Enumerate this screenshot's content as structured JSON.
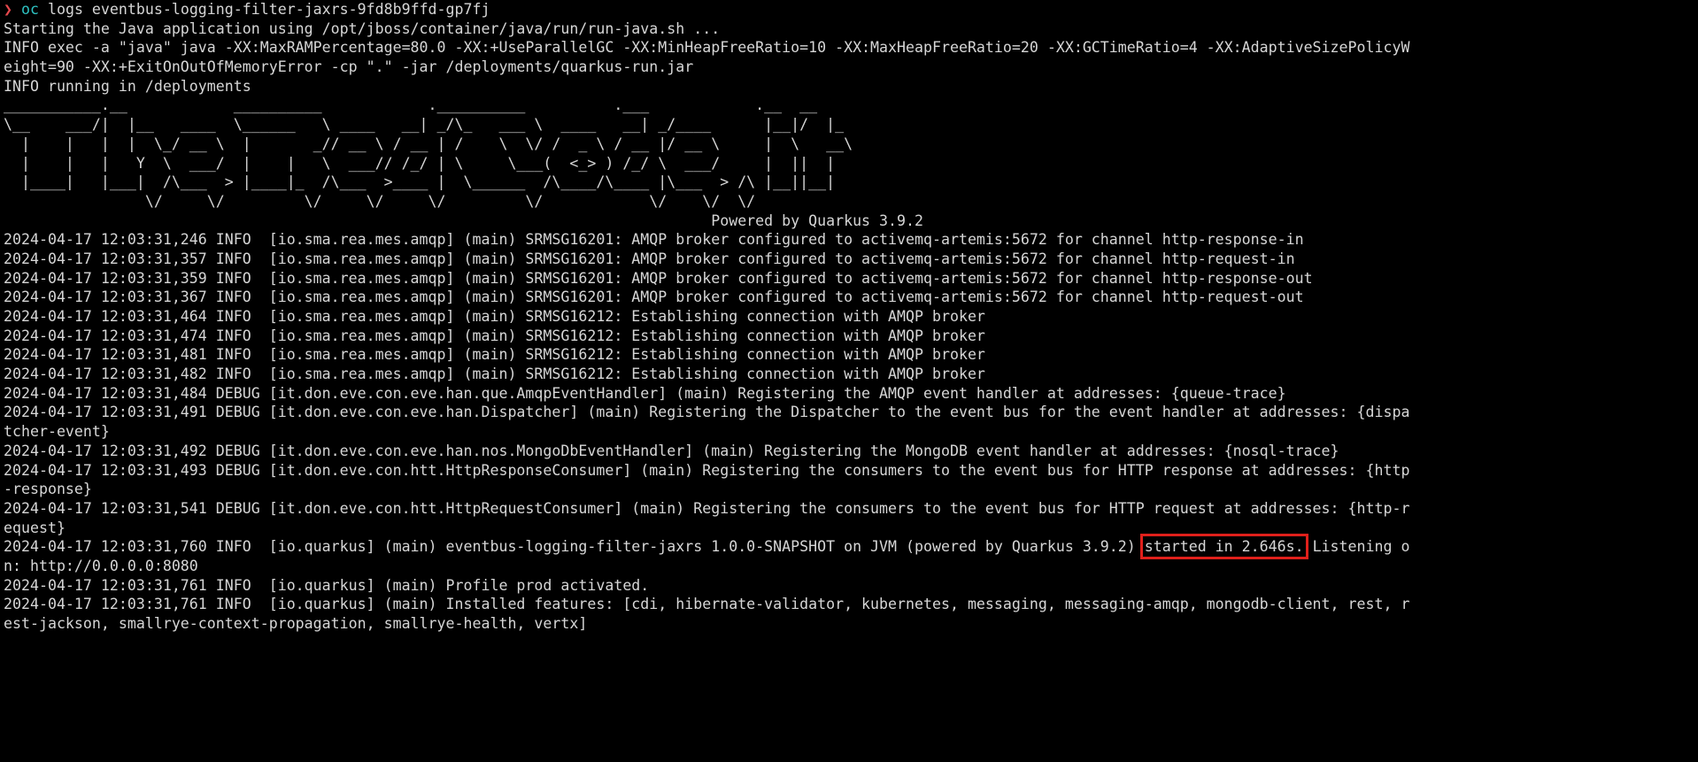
{
  "prompt": {
    "arrow": "❯",
    "command": "oc",
    "args": " logs eventbus-logging-filter-jaxrs-9fd8b9ffd-gp7fj"
  },
  "startup_lines": [
    "Starting the Java application using /opt/jboss/container/java/run/run-java.sh ...",
    "INFO exec -a \"java\" java -XX:MaxRAMPercentage=80.0 -XX:+UseParallelGC -XX:MinHeapFreeRatio=10 -XX:MaxHeapFreeRatio=20 -XX:GCTimeRatio=4 -XX:AdaptiveSizePolicyW",
    "eight=90 -XX:+ExitOnOutOfMemoryError -cp \".\" -jar /deployments/quarkus-run.jar",
    "INFO running in /deployments"
  ],
  "banner_lines": [
    "___________.__            __________            .__________          .___            .__  __",
    "\\__    ___/|  |__   ____  \\______   \\ ____   __| _/\\_   ___ \\  ____   __| _/____      |__|/  |_",
    "  |    |   |  |  \\_/ __ \\  |       _// __ \\ / __ | /    \\  \\/ /  _ \\ / __ |/ __ \\     |  \\   __\\",
    "  |    |   |   Y  \\  ___/  |    |   \\  ___// /_/ | \\     \\___(  <_> ) /_/ \\  ___/     |  ||  |",
    "  |____|   |___|  /\\___  > |____|_  /\\___  >____ |  \\______  /\\____/\\____ |\\___  > /\\ |__||__|",
    "                \\/     \\/         \\/     \\/     \\/         \\/            \\/    \\/  \\/"
  ],
  "powered_by": "                                                                                Powered by Quarkus 3.9.2",
  "log_lines": [
    "2024-04-17 12:03:31,246 INFO  [io.sma.rea.mes.amqp] (main) SRMSG16201: AMQP broker configured to activemq-artemis:5672 for channel http-response-in",
    "2024-04-17 12:03:31,357 INFO  [io.sma.rea.mes.amqp] (main) SRMSG16201: AMQP broker configured to activemq-artemis:5672 for channel http-request-in",
    "2024-04-17 12:03:31,359 INFO  [io.sma.rea.mes.amqp] (main) SRMSG16201: AMQP broker configured to activemq-artemis:5672 for channel http-response-out",
    "2024-04-17 12:03:31,367 INFO  [io.sma.rea.mes.amqp] (main) SRMSG16201: AMQP broker configured to activemq-artemis:5672 for channel http-request-out",
    "2024-04-17 12:03:31,464 INFO  [io.sma.rea.mes.amqp] (main) SRMSG16212: Establishing connection with AMQP broker",
    "2024-04-17 12:03:31,474 INFO  [io.sma.rea.mes.amqp] (main) SRMSG16212: Establishing connection with AMQP broker",
    "2024-04-17 12:03:31,481 INFO  [io.sma.rea.mes.amqp] (main) SRMSG16212: Establishing connection with AMQP broker",
    "2024-04-17 12:03:31,482 INFO  [io.sma.rea.mes.amqp] (main) SRMSG16212: Establishing connection with AMQP broker",
    "2024-04-17 12:03:31,484 DEBUG [it.don.eve.con.eve.han.que.AmqpEventHandler] (main) Registering the AMQP event handler at addresses: {queue-trace}",
    "2024-04-17 12:03:31,491 DEBUG [it.don.eve.con.eve.han.Dispatcher] (main) Registering the Dispatcher to the event bus for the event handler at addresses: {dispa",
    "tcher-event}",
    "2024-04-17 12:03:31,492 DEBUG [it.don.eve.con.eve.han.nos.MongoDbEventHandler] (main) Registering the MongoDB event handler at addresses: {nosql-trace}",
    "2024-04-17 12:03:31,493 DEBUG [it.don.eve.con.htt.HttpResponseConsumer] (main) Registering the consumers to the event bus for HTTP response at addresses: {http",
    "-response}",
    "2024-04-17 12:03:31,541 DEBUG [it.don.eve.con.htt.HttpRequestConsumer] (main) Registering the consumers to the event bus for HTTP request at addresses: {http-r",
    "equest}"
  ],
  "started_line": {
    "before": "2024-04-17 12:03:31,760 INFO  [io.quarkus] (main) eventbus-logging-filter-jaxrs 1.0.0-SNAPSHOT on JVM (powered by Quarkus 3.9.2) ",
    "highlight": "started in 2.646s.",
    "after": " Listening o"
  },
  "tail_lines": [
    "n: http://0.0.0.0:8080",
    "2024-04-17 12:03:31,761 INFO  [io.quarkus] (main) Profile prod activated.",
    "2024-04-17 12:03:31,761 INFO  [io.quarkus] (main) Installed features: [cdi, hibernate-validator, kubernetes, messaging, messaging-amqp, mongodb-client, rest, r",
    "est-jackson, smallrye-context-propagation, smallrye-health, vertx]"
  ]
}
